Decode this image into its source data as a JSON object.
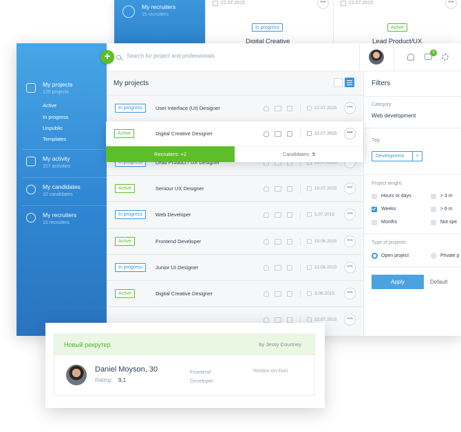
{
  "colors": {
    "accent_blue": "#3b96dc",
    "accent_green": "#5cbe29",
    "text_dark": "#2c3e50",
    "text_muted": "#9aa5ae"
  },
  "background_window": {
    "sidebar": {
      "label": "My recruiters",
      "sub": "15 recruiters",
      "icon": "shield-icon"
    },
    "cards": [
      {
        "date": "22.07.2015",
        "status": "In progress",
        "status_type": "progress",
        "title": "Digital Creative"
      },
      {
        "date": "22.07.2015",
        "status": "Active",
        "status_type": "active",
        "title": "Lead Product/UX"
      }
    ]
  },
  "sidebar": {
    "items": [
      {
        "label": "My projects",
        "sub": "120 projects",
        "icon": "folder-icon"
      },
      {
        "label": "My activity",
        "sub": "157 activities",
        "icon": "activity-icon"
      },
      {
        "label": "My candidates",
        "sub": "10 candidates",
        "icon": "candidates-icon"
      },
      {
        "label": "My recruiters",
        "sub": "15 recruiters",
        "icon": "shield-icon"
      }
    ],
    "project_subitems": [
      "Active",
      "In progress",
      "Unpublic",
      "Templates"
    ]
  },
  "topbar": {
    "search_placeholder": "Search for project and professionals",
    "chat_count": "3",
    "add_label": "+"
  },
  "projects": {
    "title": "My projects",
    "rows": [
      {
        "status": "In progress",
        "status_type": "progress",
        "title": "User Interface (UI) Designer",
        "date": "22.07.2015"
      },
      {
        "status": "Active",
        "status_type": "active",
        "title": "Digital Creative Designer",
        "date": "22.07.2015"
      },
      {
        "status": "In progress",
        "status_type": "progress",
        "title": "Lead Product / UX Designer",
        "date": "19.07.2015"
      },
      {
        "status": "Active",
        "status_type": "active",
        "title": "Seniour UX Designer",
        "date": "10.07.2015"
      },
      {
        "status": "In progress",
        "status_type": "progress",
        "title": "Web Developer",
        "date": "5.07.2015"
      },
      {
        "status": "Active",
        "status_type": "active",
        "title": "Frontend Developer",
        "date": "19.06.2015"
      },
      {
        "status": "In progress",
        "status_type": "progress",
        "title": "Junior UI Designer",
        "date": "12.06.2015"
      },
      {
        "status": "Active",
        "status_type": "active",
        "title": "Digital Creative Designer",
        "date": "3.06.2015"
      },
      {
        "status": "",
        "status_type": "progress",
        "title": "",
        "date": "22.07.2015"
      }
    ],
    "expanded_row": {
      "recruiters": "Recruiters: +2",
      "candidates_label": "Candidates:",
      "candidates_value": "5"
    },
    "more_label": "•••"
  },
  "filters": {
    "title": "Filters",
    "category_label": "Category:",
    "category_value": "Web development",
    "tag_label": "Tag:",
    "tag_value": "Development",
    "tag_remove": "×",
    "length_label": "Project lenght:",
    "length_options": [
      {
        "label": "Hours or days",
        "checked": false
      },
      {
        "label": "> 3 m",
        "checked": false
      },
      {
        "label": "Weeks",
        "checked": true
      },
      {
        "label": "> 6 m",
        "checked": false
      },
      {
        "label": "Months",
        "checked": false
      },
      {
        "label": "Not spe",
        "checked": false
      }
    ],
    "type_label": "Type of projects:",
    "type_options": [
      {
        "label": "Open project",
        "selected": true
      },
      {
        "label": "Private p",
        "selected": false
      }
    ],
    "apply_label": "Apply",
    "default_label": "Default"
  },
  "notification": {
    "title": "Новый рекрутер",
    "author": "by Jessy Courtney",
    "name": "Daniel Moyson, 30",
    "rating_label": "Rating:",
    "rating_value": "9,1",
    "role": "Frontend Developer",
    "city": "Rostov-on-Don"
  }
}
